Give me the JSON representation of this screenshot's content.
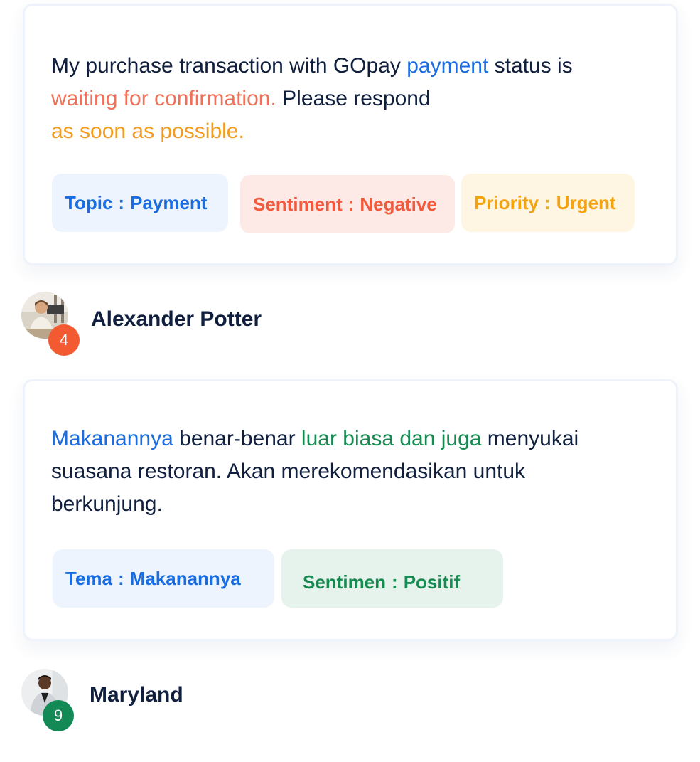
{
  "reviews": [
    {
      "message": {
        "p1": "My purchase transaction with GOpay ",
        "h1": "payment",
        "p2": " status is ",
        "h2": "waiting for confirmation.",
        "p3": " Please respond ",
        "h3": "as soon as possible."
      },
      "tags": [
        {
          "key": "Topic",
          "sep": ":",
          "value": "Payment"
        },
        {
          "key": "Sentiment",
          "sep": ":",
          "value": "Negative"
        },
        {
          "key": "Priority",
          "sep": ":",
          "value": "Urgent"
        }
      ],
      "user": {
        "name": "Alexander Potter",
        "count": "4"
      }
    },
    {
      "message": {
        "h1": "Makanannya",
        "p1": " benar-benar ",
        "h2": "luar biasa dan juga",
        "p2": " menyukai suasana restoran. Akan merekomendasikan untuk berkunjung."
      },
      "tags": [
        {
          "key": "Tema",
          "sep": ":",
          "value": "Makanannya"
        },
        {
          "key": "Sentimen",
          "sep": ":",
          "value": "Positif"
        }
      ],
      "user": {
        "name": "Maryland",
        "count": "9"
      }
    }
  ],
  "icons": {
    "avatar_1": "person-photo",
    "avatar_2": "person-photo"
  },
  "colors": {
    "blue": "#1a6de0",
    "coral": "#f0705a",
    "amber": "#f39b1e",
    "green": "#178a52",
    "badge_red": "#f35a32",
    "badge_green": "#138a55"
  }
}
